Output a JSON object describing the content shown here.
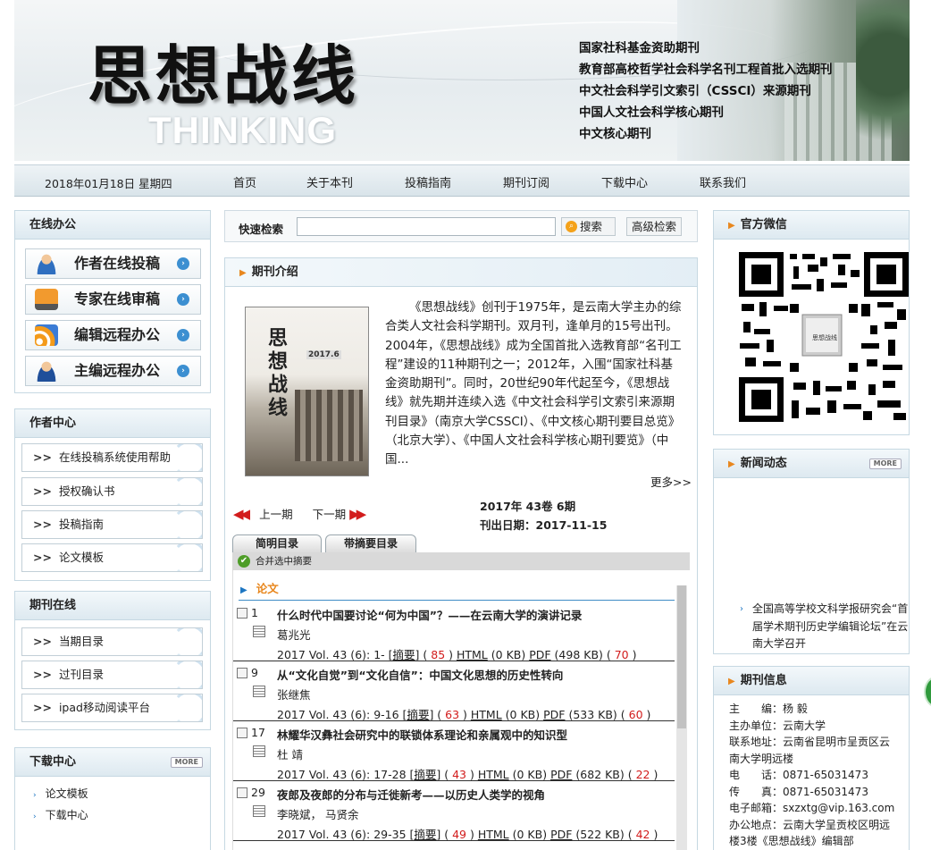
{
  "banner": {
    "logo_cn": "思想战线",
    "logo_en": "THINKING",
    "certifications": [
      "国家社科基金资助期刊",
      "教育部高校哲学社会科学名刊工程首批入选期刊",
      "中文社会科学引文索引（CSSCI）来源期刊",
      "中国人文社会科学核心期刊",
      "中文核心期刊"
    ]
  },
  "nav": {
    "date": "2018年01月18日 星期四",
    "items": [
      "首页",
      "关于本刊",
      "投稿指南",
      "期刊订阅",
      "下载中心",
      "联系我们"
    ]
  },
  "left": {
    "office_title": "在线办公",
    "office_buttons": [
      "作者在线投稿",
      "专家在线审稿",
      "编辑远程办公",
      "主编远程办公"
    ],
    "author_title": "作者中心",
    "author_links": [
      "在线投稿系统使用帮助",
      "授权确认书",
      "投稿指南",
      "论文模板"
    ],
    "journal_title": "期刊在线",
    "journal_links": [
      "当期目录",
      "过刊目录",
      "ipad移动阅读平台"
    ],
    "download_title": "下载中心",
    "download_more": "MORE",
    "download_links": [
      "论文模板",
      "下载中心"
    ]
  },
  "search": {
    "label": "快速检索",
    "button": "搜索",
    "advanced": "高级检索"
  },
  "intro": {
    "title": "期刊介绍",
    "text": "《思想战线》创刊于1975年，是云南大学主办的综合类人文社会科学期刊。双月刊，逢单月的15号出刊。2004年，《思想战线》成为全国首批入选教育部“名刊工程”建设的11种期刊之一；2012年，入围“国家社科基金资助期刊”。同时，20世纪90年代起至今，《思想战线》就先期并连续入选《中文社会科学引文索引来源期刊目录》（南京大学CSSCI）、《中文核心期刊要目总览》（北京大学）、《中国人文社会科学核心期刊要览》（中国...",
    "more": "更多>>",
    "cover_title": "思想战线",
    "cover_year": "2017.6"
  },
  "issue": {
    "prev": "上一期",
    "next": "下一期",
    "volume": "2017年 43卷 6期",
    "pubdate": "刊出日期：2017-11-15"
  },
  "toc": {
    "tabs": [
      "简明目录",
      "带摘要目录"
    ],
    "merge": "合并选中摘要",
    "section": "论文",
    "articles": [
      {
        "no": "1",
        "title": "什么时代中国要讨论“何为中国”？——在云南大学的演讲记录",
        "author": "葛兆光",
        "cite": "2017 Vol. 43 (6): 1- [",
        "abs": "摘要",
        "v1": "85",
        "html": "HTML",
        "hs": "(0 KB)",
        "pdf": "PDF",
        "ps": "(498 KB)",
        "v2": "70"
      },
      {
        "no": "9",
        "title": "从“文化自觉”到“文化自信”：中国文化思想的历史性转向",
        "author": "张继焦",
        "cite": "2017 Vol. 43 (6): 9-16 [",
        "abs": "摘要",
        "v1": "63",
        "html": "HTML",
        "hs": "(0 KB)",
        "pdf": "PDF",
        "ps": "(533 KB)",
        "v2": "60"
      },
      {
        "no": "17",
        "title": "林耀华汉彝社会研究中的联锁体系理论和亲属观中的知识型",
        "author": "杜 靖",
        "cite": "2017 Vol. 43 (6): 17-28 [",
        "abs": "摘要",
        "v1": "43",
        "html": "HTML",
        "hs": "(0 KB)",
        "pdf": "PDF",
        "ps": "(682 KB)",
        "v2": "22"
      },
      {
        "no": "29",
        "title": "夜郎及夜郎的分布与迁徙新考——以历史人类学的视角",
        "author": "李晓斌， 马贤余",
        "cite": "2017 Vol. 43 (6): 29-35 [",
        "abs": "摘要",
        "v1": "49",
        "html": "HTML",
        "hs": "(0 KB)",
        "pdf": "PDF",
        "ps": "(522 KB)",
        "v2": "42"
      }
    ]
  },
  "right": {
    "wechat_title": "官方微信",
    "news_title": "新闻动态",
    "news_more": "MORE",
    "news_item": "全国高等学校文科学报研究会“首届学术期刊历史学编辑论坛”在云南大学召开",
    "info_title": "期刊信息",
    "info": [
      "主　　编：杨 毅",
      "主办单位：云南大学",
      "联系地址：云南省昆明市呈贡区云南大学明远楼",
      "电　　话：0871-65031473",
      "传　　真：0871-65031473",
      "电子邮箱：sxzxtg@vip.163.com",
      "办公地点：云南大学呈贡校区明远楼3楼《思想战线》编辑部"
    ]
  }
}
